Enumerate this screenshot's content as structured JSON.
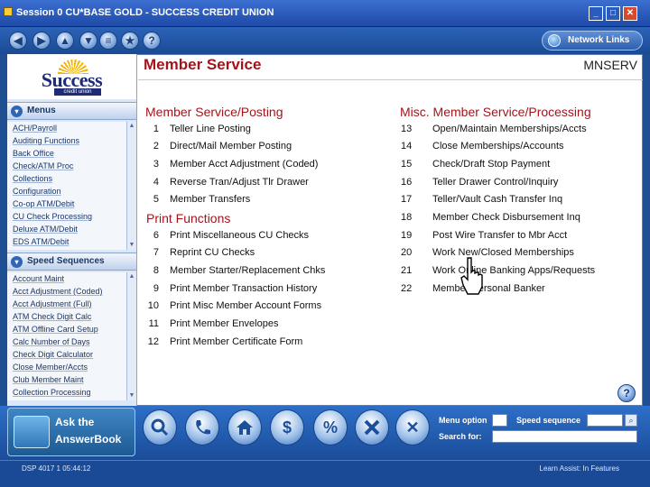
{
  "window": {
    "title": "Session 0 CU*BASE GOLD - SUCCESS CREDIT UNION"
  },
  "toolbar": {
    "nav_icons": [
      "back-icon",
      "forward-icon",
      "up-icon",
      "down-icon",
      "menu-icon",
      "favorite-icon",
      "help-icon"
    ],
    "network_links": "Network Links"
  },
  "logo": {
    "word": "Success",
    "sub": "credit union"
  },
  "sidebar": {
    "menus_title": "Menus",
    "menus": [
      "ACH/Payroll",
      "Auditing Functions",
      "Back Office",
      "Check/ATM Proc",
      "Collections",
      "Configuration",
      "Co-op ATM/Debit",
      "CU Check Processing",
      "Deluxe ATM/Debit",
      "EDS ATM/Debit"
    ],
    "speed_title": "Speed Sequences",
    "speed": [
      "Account Maint",
      "Acct Adjustment (Coded)",
      "Acct Adjustment (Full)",
      "ATM Check Digit Calc",
      "ATM Offline Card Setup",
      "Calc Number of Days",
      "Check Digit Calculator",
      "Close Member/Accts",
      "Club Member Maint",
      "Collection Processing"
    ]
  },
  "page": {
    "title": "Member Service",
    "code": "MNSERV"
  },
  "left_col": {
    "heading1": "Member Service/Posting",
    "items1": [
      {
        "num": "1",
        "label": "Teller Line Posting"
      },
      {
        "num": "2",
        "label": "Direct/Mail Member Posting"
      },
      {
        "num": "3",
        "label": "Member Acct Adjustment (Coded)"
      },
      {
        "num": "4",
        "label": "Reverse Tran/Adjust Tlr Drawer"
      },
      {
        "num": "5",
        "label": "Member Transfers"
      }
    ],
    "heading2": "Print Functions",
    "items2": [
      {
        "num": "6",
        "label": "Print Miscellaneous CU Checks"
      },
      {
        "num": "7",
        "label": "Reprint CU Checks"
      },
      {
        "num": "8",
        "label": "Member Starter/Replacement Chks"
      },
      {
        "num": "9",
        "label": "Print Member Transaction History"
      },
      {
        "num": "10",
        "label": "Print Misc Member Account Forms"
      },
      {
        "num": "11",
        "label": "Print Member Envelopes"
      },
      {
        "num": "12",
        "label": "Print Member Certificate Form"
      }
    ]
  },
  "right_col": {
    "heading": "Misc. Member Service/Processing",
    "items": [
      {
        "num": "13",
        "label": "Open/Maintain Memberships/Accts"
      },
      {
        "num": "14",
        "label": "Close Memberships/Accounts"
      },
      {
        "num": "15",
        "label": "Check/Draft Stop Payment"
      },
      {
        "num": "16",
        "label": "Teller Drawer Control/Inquiry"
      },
      {
        "num": "17",
        "label": "Teller/Vault Cash Transfer Inq"
      },
      {
        "num": "18",
        "label": "Member Check Disbursement Inq"
      },
      {
        "num": "19",
        "label": "Post Wire Transfer to Mbr Acct"
      },
      {
        "num": "20",
        "label": "Work New/Closed Memberships"
      },
      {
        "num": "21",
        "label": "Work Online Banking Apps/Requests"
      },
      {
        "num": "22",
        "label": "Member Personal Banker"
      }
    ]
  },
  "bottom": {
    "ask_line1": "Ask the",
    "ask_line2": "AnswerBook",
    "buttons": [
      "search-icon",
      "phone-icon",
      "home-icon",
      "money-bag-icon",
      "percent-icon",
      "tools-icon",
      "exit-icon"
    ],
    "button_glyphs": [
      "",
      "",
      "",
      "$",
      "%",
      "",
      "✕"
    ],
    "menu_option_label": "Menu option",
    "speed_sequence_label": "Speed sequence",
    "search_for_label": "Search for:"
  },
  "status": {
    "left": "DSP 4017 1 05:44:12",
    "right": "Learn Assist: In Features"
  }
}
